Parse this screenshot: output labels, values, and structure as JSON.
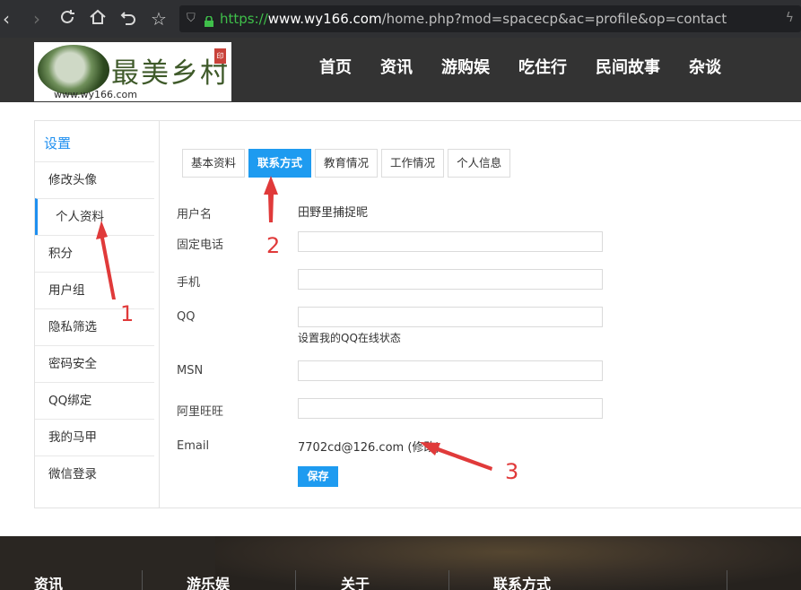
{
  "browser": {
    "url_scheme": "https://",
    "url_host": "www.wy166.com",
    "url_path": "/home.php?mod=spacecp&ac=profile&op=contact",
    "icons": [
      "back-icon",
      "forward-icon",
      "reload-icon",
      "home-icon",
      "undo-icon",
      "star-icon",
      "shield-icon",
      "lock-icon",
      "bolt-icon"
    ]
  },
  "header": {
    "logo_text": "最美乡村",
    "logo_url": "www.wy166.com",
    "nav": [
      "首页",
      "资讯",
      "游购娱",
      "吃住行",
      "民间故事",
      "杂谈"
    ]
  },
  "sidebar": {
    "title": "设置",
    "items": [
      "修改头像",
      "个人资料",
      "积分",
      "用户组",
      "隐私筛选",
      "密码安全",
      "QQ绑定",
      "我的马甲",
      "微信登录"
    ],
    "active_index": 1
  },
  "tabs": {
    "items": [
      "基本资料",
      "联系方式",
      "教育情况",
      "工作情况",
      "个人信息"
    ],
    "active_index": 1
  },
  "form": {
    "username_label": "用户名",
    "username_value": "田野里捕捉昵",
    "phone_label": "固定电话",
    "mobile_label": "手机",
    "qq_label": "QQ",
    "qq_hint": "设置我的QQ在线状态",
    "msn_label": "MSN",
    "wangwang_label": "阿里旺旺",
    "email_label": "Email",
    "email_value": "7702cd@126.com",
    "email_edit": "(修改)",
    "save_label": "保存"
  },
  "annotations": [
    "1",
    "2",
    "3"
  ],
  "footer": {
    "columns": [
      "资讯",
      "游乐娱",
      "关于",
      "联系方式"
    ]
  },
  "colors": {
    "accent": "#1e9bf0",
    "annotation": "#e03a3a",
    "header_bg": "#333333"
  }
}
